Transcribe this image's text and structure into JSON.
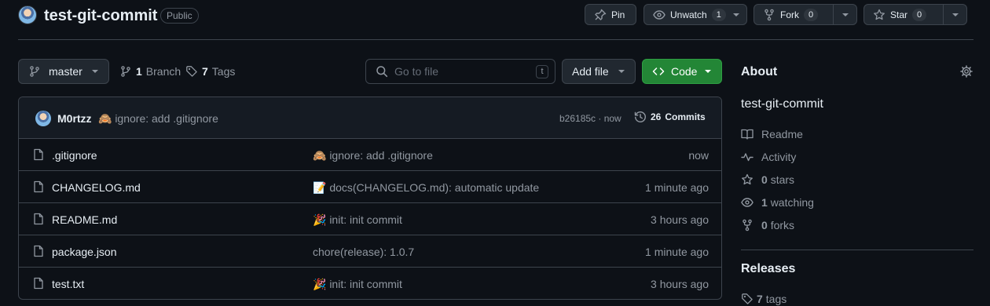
{
  "repo": {
    "name": "test-git-commit",
    "visibility": "Public"
  },
  "header_actions": {
    "pin_label": "Pin",
    "unwatch_label": "Unwatch",
    "unwatch_count": "1",
    "fork_label": "Fork",
    "fork_count": "0",
    "star_label": "Star",
    "star_count": "0"
  },
  "toolbar": {
    "branch": "master",
    "branches_count": "1",
    "branches_label": "Branch",
    "tags_count": "7",
    "tags_label": "Tags",
    "search_placeholder": "Go to file",
    "search_shortcut": "t",
    "add_file_label": "Add file",
    "code_label": "Code"
  },
  "latest_commit": {
    "author": "M0rtzz",
    "message": "🙈 ignore: add .gitignore",
    "hash_time": "b26185c · now",
    "commits_count": "26",
    "commits_label": "Commits"
  },
  "files": [
    {
      "name": ".gitignore",
      "commit": "🙈 ignore: add .gitignore",
      "time": "now"
    },
    {
      "name": "CHANGELOG.md",
      "commit": "📝 docs(CHANGELOG.md): automatic update",
      "time": "1 minute ago"
    },
    {
      "name": "README.md",
      "commit": "🎉 init: init commit",
      "time": "3 hours ago"
    },
    {
      "name": "package.json",
      "commit": "chore(release): 1.0.7",
      "time": "1 minute ago"
    },
    {
      "name": "test.txt",
      "commit": "🎉 init: init commit",
      "time": "3 hours ago"
    }
  ],
  "sidebar": {
    "about_title": "About",
    "description": "test-git-commit",
    "readme": "Readme",
    "activity": "Activity",
    "stars_count": "0",
    "stars_label": "stars",
    "watching_count": "1",
    "watching_label": "watching",
    "forks_count": "0",
    "forks_label": "forks",
    "releases_title": "Releases",
    "release_tags_count": "7",
    "release_tags_label": "tags"
  },
  "colors": {
    "background": "#0d1117",
    "border": "#3d444d",
    "button_bg": "#212830",
    "code_button": "#238636",
    "muted_text": "#9198a1"
  }
}
